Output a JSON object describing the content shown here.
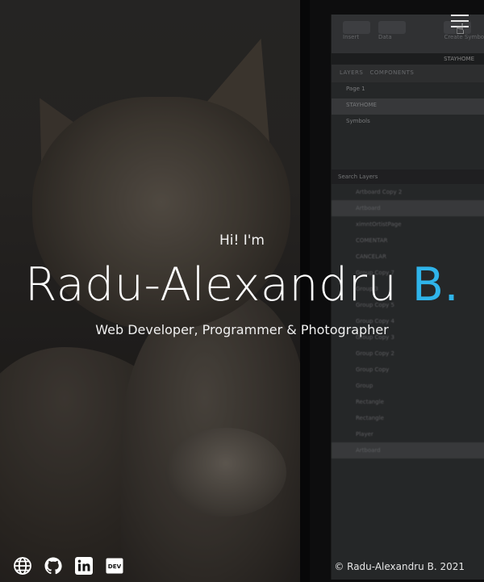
{
  "hero": {
    "intro": "Hi! I'm",
    "name_main": "Radu-Alexandru",
    "name_accent": "B.",
    "tagline": "Web Developer, Programmer & Photographer"
  },
  "footer": {
    "copyright": "© Radu-Alexandru B. 2021",
    "socials": [
      "globe-icon",
      "github-icon",
      "linkedin-icon",
      "dev-icon"
    ]
  },
  "background_screen": {
    "toolbar": [
      "Insert",
      "Data",
      "Create Symbol"
    ],
    "document": "STAYHOME",
    "tabs": [
      "LAYERS",
      "COMPONENTS"
    ],
    "pages": [
      "Page 1",
      "STAYHOME",
      "Symbols"
    ],
    "search_placeholder": "Search Layers",
    "layers": [
      "Artboard Copy 2",
      "Artboard",
      "ximntOrtistPage",
      "COMENTAR",
      "CANCELAR",
      "Group Copy 7",
      "Group 3",
      "Group Copy 5",
      "Group Copy 4",
      "Group Copy 3",
      "Group Copy 2",
      "Group Copy",
      "Group",
      "Rectangle",
      "Rectangle",
      "Player",
      "Artboard"
    ]
  },
  "colors": {
    "accent": "#2fb4ea",
    "text": "#ffffff"
  }
}
